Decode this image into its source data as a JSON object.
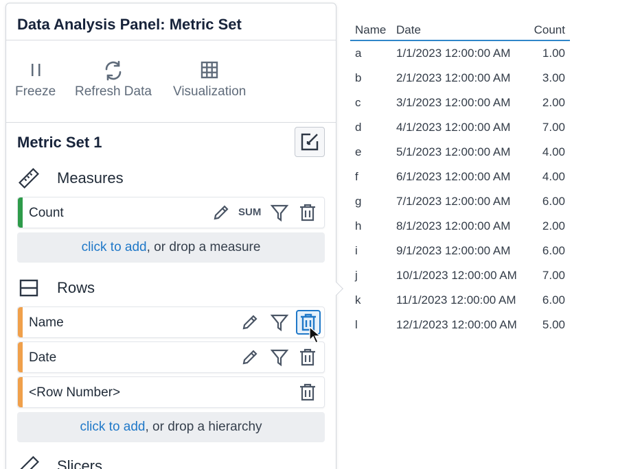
{
  "panel": {
    "title": "Data Analysis Panel: Metric Set",
    "toolbar": {
      "freeze": "Freeze",
      "refresh": "Refresh Data",
      "visualization": "Visualization"
    },
    "metric_set_title": "Metric Set 1",
    "measures": {
      "label": "Measures",
      "items": [
        {
          "name": "Count",
          "aggregation": "SUM",
          "color": "#2e9b4a"
        }
      ],
      "dropzone": {
        "link": "click to add",
        "rest": ", or drop a measure"
      }
    },
    "rows": {
      "label": "Rows",
      "items": [
        {
          "name": "Name",
          "color": "#f0a04b"
        },
        {
          "name": "Date",
          "color": "#f0a04b"
        },
        {
          "name": "<Row Number>",
          "color": "#f0a04b"
        }
      ],
      "dropzone": {
        "link": "click to add",
        "rest": ", or drop a hierarchy"
      }
    },
    "slicers": {
      "label": "Slicers"
    }
  },
  "table": {
    "columns": [
      "Name",
      "Date",
      "Count"
    ],
    "rows": [
      [
        "a",
        "1/1/2023 12:00:00 AM",
        "1.00"
      ],
      [
        "b",
        "2/1/2023 12:00:00 AM",
        "3.00"
      ],
      [
        "c",
        "3/1/2023 12:00:00 AM",
        "2.00"
      ],
      [
        "d",
        "4/1/2023 12:00:00 AM",
        "7.00"
      ],
      [
        "e",
        "5/1/2023 12:00:00 AM",
        "4.00"
      ],
      [
        "f",
        "6/1/2023 12:00:00 AM",
        "4.00"
      ],
      [
        "g",
        "7/1/2023 12:00:00 AM",
        "6.00"
      ],
      [
        "h",
        "8/1/2023 12:00:00 AM",
        "2.00"
      ],
      [
        "i",
        "9/1/2023 12:00:00 AM",
        "6.00"
      ],
      [
        "j",
        "10/1/2023 12:00:00 AM",
        "7.00"
      ],
      [
        "k",
        "11/1/2023 12:00:00 AM",
        "6.00"
      ],
      [
        "l",
        "12/1/2023 12:00:00 AM",
        "5.00"
      ]
    ]
  },
  "colors": {
    "accent": "#1f78c8",
    "measure_bar": "#2e9b4a",
    "row_bar": "#f0a04b"
  }
}
